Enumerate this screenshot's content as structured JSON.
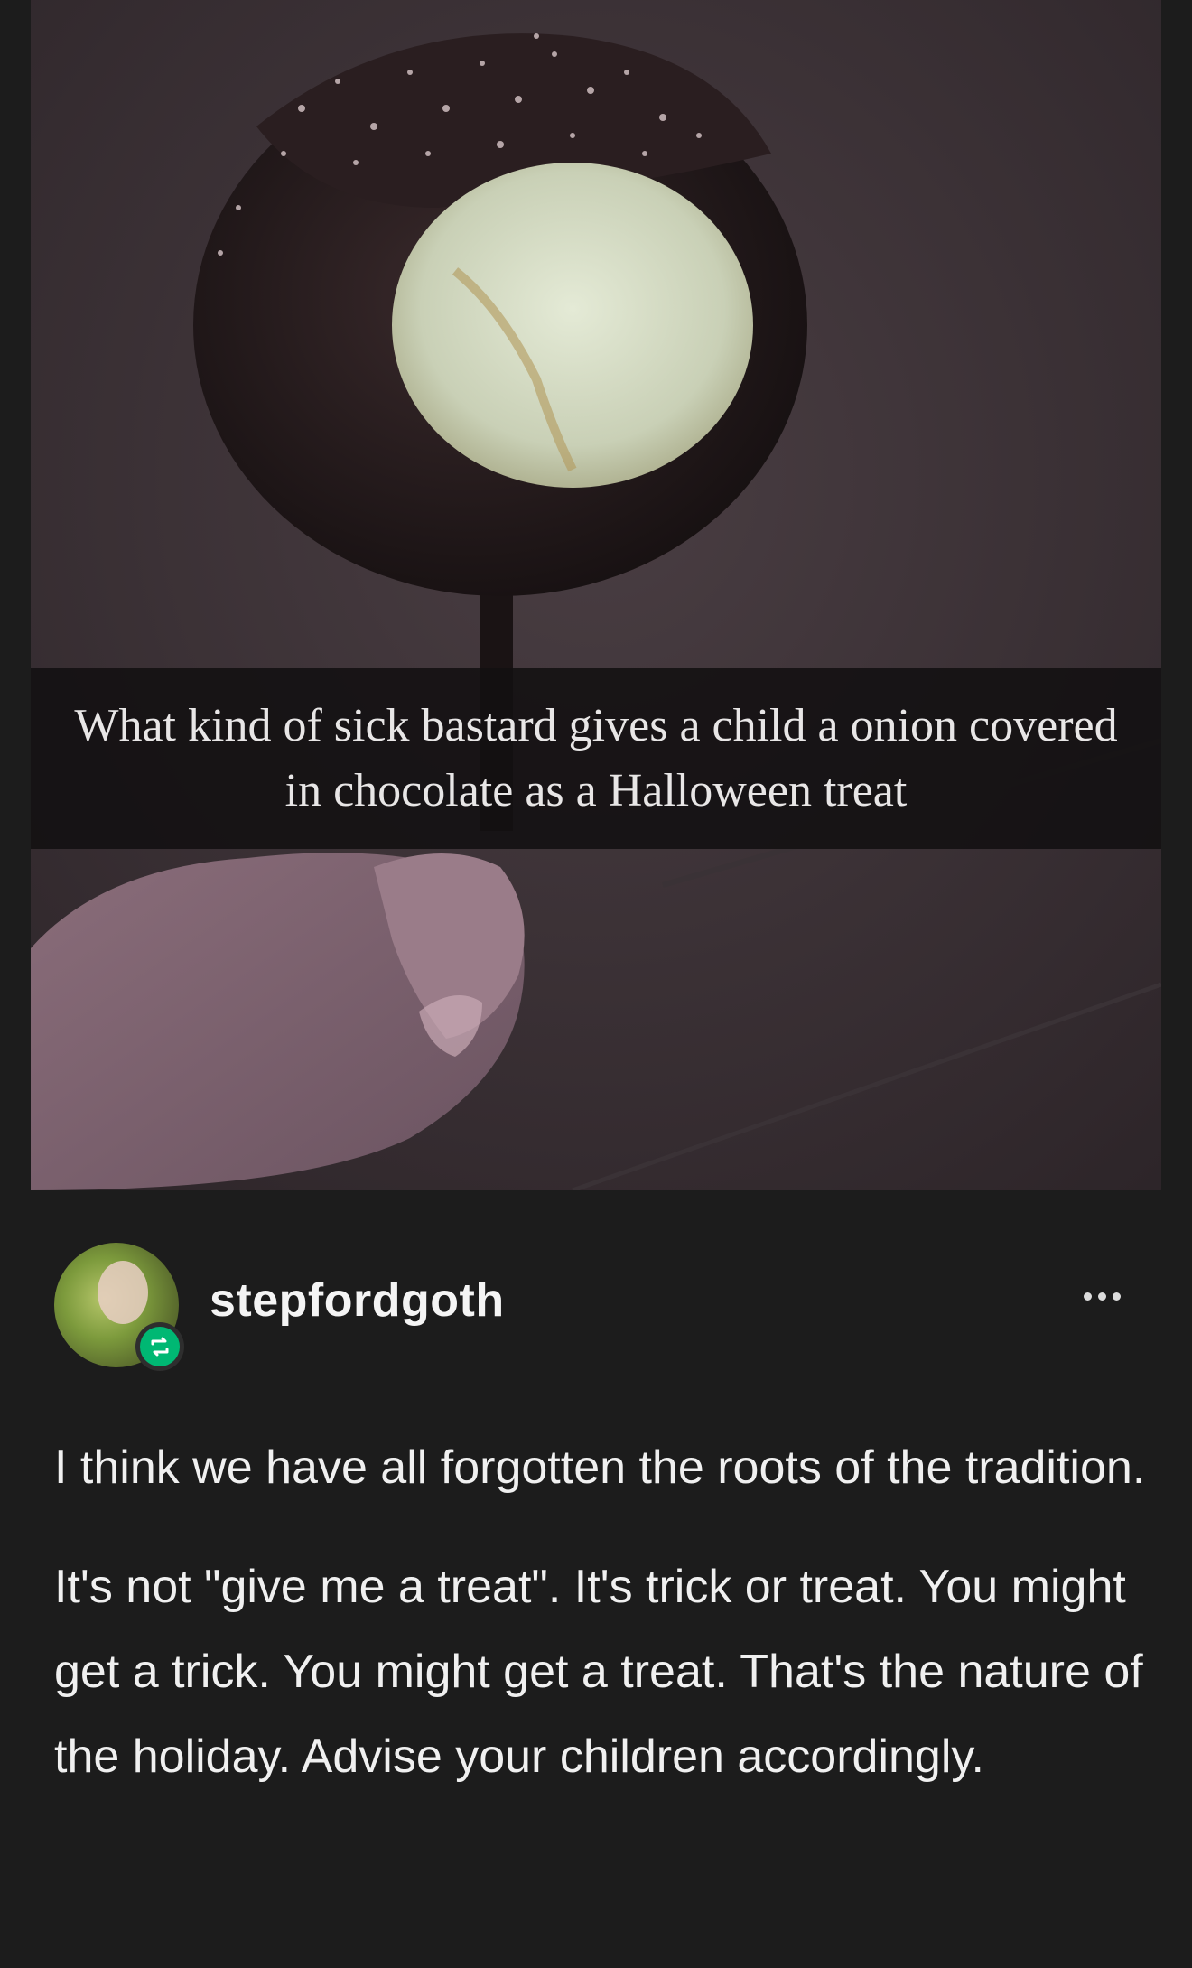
{
  "photo": {
    "caption": "What kind of sick bastard gives a child a onion covered in chocolate as a Halloween treat"
  },
  "post": {
    "username": "stepfordgoth",
    "avatar_icon": "avatar-photo",
    "badge_icon": "reblog-icon",
    "menu_icon": "more-options-icon",
    "accent_color": "#00b873",
    "paragraphs": [
      "I think we have all forgotten the roots of the tradition.",
      "It's not \"give me a treat\". It's trick or treat. You might get a trick. You might get a treat. That's the nature of the holiday. Advise your children accordingly."
    ]
  }
}
